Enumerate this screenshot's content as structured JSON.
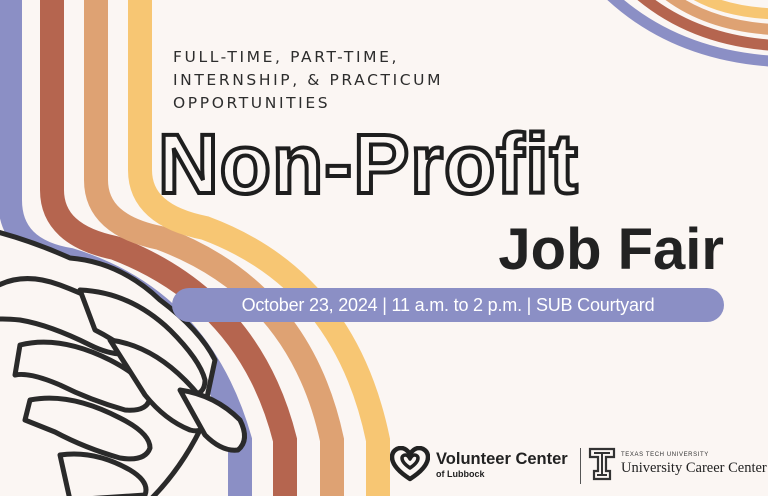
{
  "subtitle": {
    "line1": "FULL-TIME, PART-TIME,",
    "line2": "INTERNSHIP, & PRACTICUM",
    "line3": "OPPORTUNITIES"
  },
  "title": {
    "line1": "Non-Profit",
    "line2": "Job Fair"
  },
  "event_info": "October 23, 2024 | 11 a.m. to 2 p.m. | SUB Courtyard",
  "logos": {
    "volunteer_center": {
      "name": "Volunteer Center",
      "sub": "of Lubbock"
    },
    "ttu": {
      "small": "TEXAS TECH UNIVERSITY",
      "name": "University Career Center"
    }
  },
  "colors": {
    "background": "#fbf6f3",
    "lavender": "#8b8fc5",
    "rust": "#b5654f",
    "tan": "#dea273",
    "gold": "#f7c673",
    "ink": "#222222"
  }
}
